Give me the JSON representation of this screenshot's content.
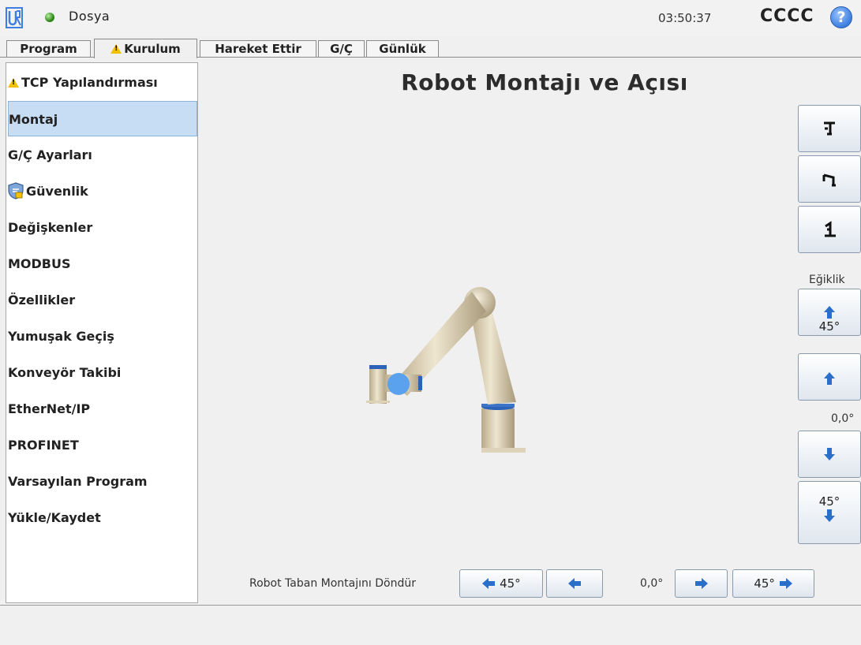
{
  "header": {
    "file_menu": "Dosya",
    "clock": "03:50:37",
    "robot_name": "CCCC",
    "help_symbol": "?",
    "status_color": "#3a9a1c"
  },
  "tabs": [
    {
      "label": "Program"
    },
    {
      "label": "Kurulum",
      "warning": true
    },
    {
      "label": "Hareket Ettir"
    },
    {
      "label": "G/Ç"
    },
    {
      "label": "Günlük"
    }
  ],
  "sidebar": {
    "items": [
      {
        "label": "TCP Yapılandırması",
        "icon": "warning-icon"
      },
      {
        "label": "Montaj",
        "selected": true
      },
      {
        "label": "G/Ç Ayarları"
      },
      {
        "label": "Güvenlik",
        "icon": "security-shield-icon"
      },
      {
        "label": "Değişkenler"
      },
      {
        "label": "MODBUS"
      },
      {
        "label": "Özellikler"
      },
      {
        "label": "Yumuşak Geçiş"
      },
      {
        "label": "Konveyör Takibi"
      },
      {
        "label": "EtherNet/IP"
      },
      {
        "label": "PROFINET"
      },
      {
        "label": "Varsayılan Program"
      },
      {
        "label": "Yükle/Kaydet"
      }
    ]
  },
  "main": {
    "title": "Robot Montajı ve Açısı",
    "tilt": {
      "label": "Eğiklik",
      "up_45_label": "45°",
      "value": "0,0°",
      "down_45_label": "45°"
    },
    "rotate": {
      "label": "Robot Taban Montajını Döndür",
      "left_45_label": "45°",
      "value": "0,0°",
      "right_45_label": "45°"
    }
  },
  "colors": {
    "accent_blue": "#2a6fc9",
    "selected_bg": "#c6ddf4",
    "warning": "#f2c200"
  }
}
